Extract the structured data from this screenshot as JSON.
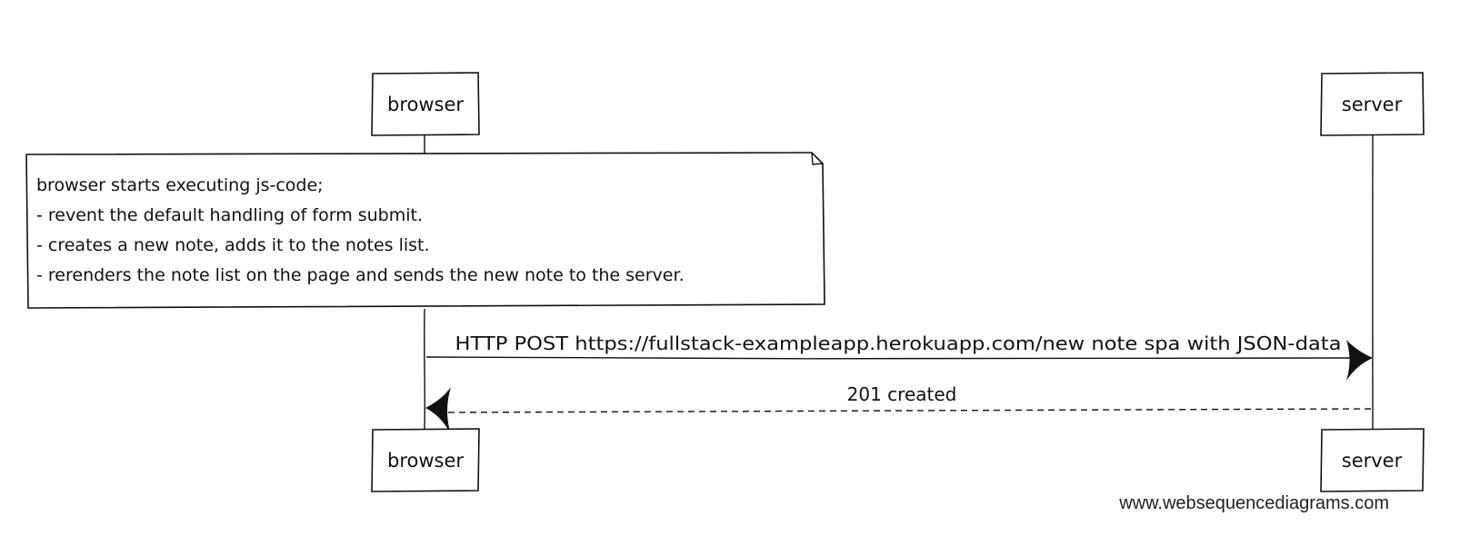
{
  "participants": {
    "browser": "browser",
    "server": "server"
  },
  "note": {
    "lines": [
      "browser starts executing js-code;",
      "- revent the default handling of form submit.",
      "- creates a new note, adds it to the notes list.",
      "- rerenders the note list on the page and sends the new note to the server."
    ]
  },
  "messages": {
    "request": "HTTP POST https://fullstack-exampleapp.herokuapp.com/new note spa with JSON-data",
    "response": "201 created"
  },
  "watermark": "www.websequencediagrams.com"
}
